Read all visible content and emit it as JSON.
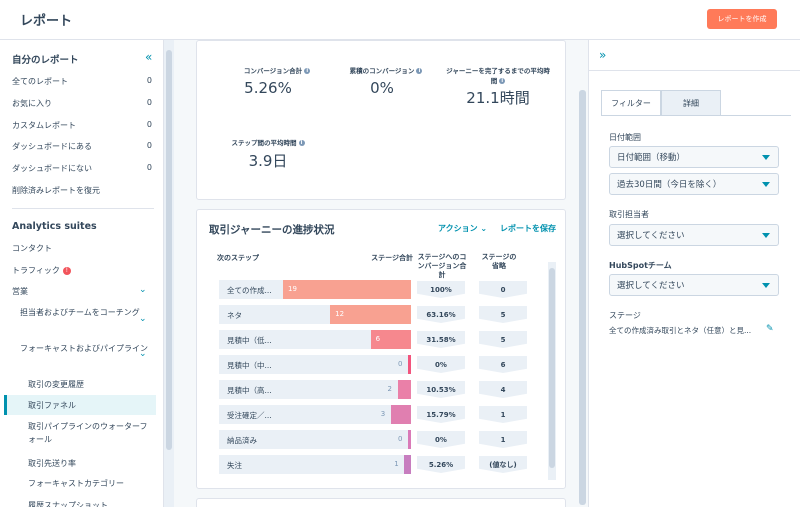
{
  "header": {
    "title": "レポート",
    "create_button": "レポートを作成"
  },
  "sidebar": {
    "my_reports_title": "自分のレポート",
    "collapse_icon": "«",
    "items": [
      {
        "label": "全てのレポート",
        "count": "0"
      },
      {
        "label": "お気に入り",
        "count": "0"
      },
      {
        "label": "カスタムレポート",
        "count": "0"
      },
      {
        "label": "ダッシュボードにある",
        "count": "0"
      },
      {
        "label": "ダッシュボードにない",
        "count": "0"
      },
      {
        "label": "削除済みレポートを復元",
        "count": ""
      }
    ],
    "analytics_title": "Analytics suites",
    "contacts": "コンタクト",
    "traffic": "トラフィック",
    "sales": "営業",
    "coaching": "担当者およびチームをコーチング",
    "forecast_pipeline": "フォーキャストおよびパイプライン",
    "leaves": [
      "取引の変更履歴",
      "取引ファネル",
      "取引パイプラインのウォーターフォール",
      "取引先送り率",
      "フォーキャストカテゴリー",
      "履歴スナップショット"
    ]
  },
  "kpis": [
    {
      "label": "コンバージョン合計",
      "value": "5.26%"
    },
    {
      "label": "累積のコンバージョン",
      "value": "0%"
    },
    {
      "label": "ジャーニーを完了するまでの平均時間",
      "value": "21.1時間"
    },
    {
      "label": "ステップ間の平均時間",
      "value": "3.9日"
    }
  ],
  "funnel": {
    "title": "取引ジャーニーの進捗状況",
    "action_label": "アクション",
    "save_label": "レポートを保存",
    "col_next_step": "次のステップ",
    "col_stage_total": "ステージ合計",
    "col_conversion": "ステージへのコンバージョン合計",
    "col_skip": "ステージの省略",
    "max_total": 19,
    "rows": [
      {
        "label": "全ての作成...",
        "total": "19",
        "value": 19,
        "conversion": "100%",
        "skip": "0",
        "color": "#f8a191"
      },
      {
        "label": "ネタ",
        "total": "12",
        "value": 12,
        "conversion": "63.16%",
        "skip": "5",
        "color": "#f8a191"
      },
      {
        "label": "見積中（低...",
        "total": "6",
        "value": 6,
        "conversion": "31.58%",
        "skip": "5",
        "color": "#f6888e"
      },
      {
        "label": "見積中（中...",
        "total": "0",
        "value": 0,
        "conversion": "0%",
        "skip": "6",
        "color": "#f2547d"
      },
      {
        "label": "見積中（高...",
        "total": "2",
        "value": 2,
        "conversion": "10.53%",
        "skip": "4",
        "color": "#ea80a8"
      },
      {
        "label": "受注確定／...",
        "total": "3",
        "value": 3,
        "conversion": "15.79%",
        "skip": "1",
        "color": "#e07fb0"
      },
      {
        "label": "納品済み",
        "total": "0",
        "value": 0,
        "conversion": "0%",
        "skip": "1",
        "color": "#d97ab8"
      },
      {
        "label": "失注",
        "total": "1",
        "value": 1,
        "conversion": "5.26%",
        "skip": "(値なし)",
        "color": "#c77dbf"
      }
    ]
  },
  "filters": {
    "expand_icon": "»",
    "tab_filter": "フィルター",
    "tab_detail": "詳細",
    "date_range_label": "日付範囲",
    "date_range_type": "日付範囲（移動）",
    "date_range_value": "過去30日間（今日を除く）",
    "owner_label": "取引担当者",
    "owner_value": "選択してください",
    "team_label": "HubSpotチーム",
    "team_value": "選択してください",
    "stage_label": "ステージ",
    "stage_value": "全ての作成済み取引とネタ（任意）と見..."
  }
}
